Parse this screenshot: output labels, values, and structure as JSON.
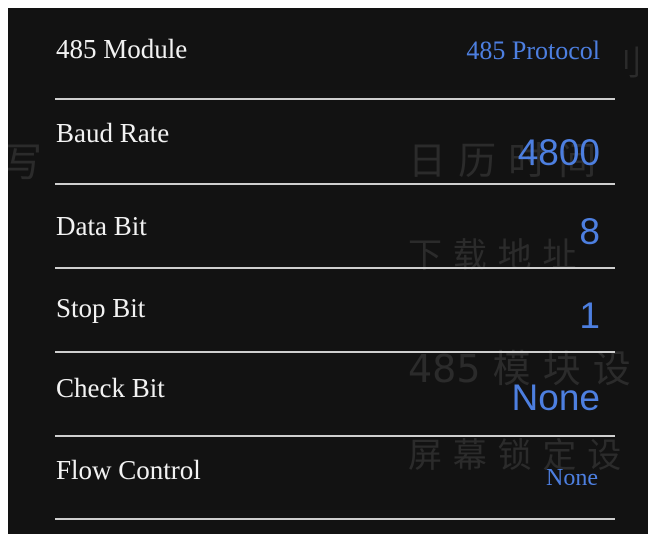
{
  "settings": {
    "rows": [
      {
        "label": "485 Module",
        "value": "485 Protocol"
      },
      {
        "label": "Baud Rate",
        "value": "4800"
      },
      {
        "label": "Data Bit",
        "value": "8"
      },
      {
        "label": "Stop Bit",
        "value": "1"
      },
      {
        "label": "Check Bit",
        "value": "None"
      },
      {
        "label": "Flow Control",
        "value": "None"
      }
    ]
  },
  "colors": {
    "background": "#121212",
    "label_text": "#f2f2f2",
    "value_text": "#4d7fe0",
    "divider": "#cfcfcf"
  }
}
